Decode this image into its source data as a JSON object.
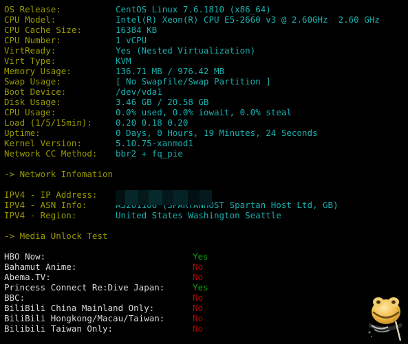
{
  "terminal": {
    "background": "#000000",
    "label_color": "#9a9a00",
    "value_color": "#1ab0b0",
    "media_label_color": "#d9d9d9",
    "yes_color": "#0ea60e",
    "no_color": "#c00000"
  },
  "system_info": [
    {
      "label": "OS Release:",
      "value": "CentOS Linux 7.6.1810 (x86_64)"
    },
    {
      "label": "CPU Model:",
      "value": "Intel(R) Xeon(R) CPU E5-2660 v3 @ 2.60GHz  2.60 GHz"
    },
    {
      "label": "CPU Cache Size:",
      "value": "16384 KB"
    },
    {
      "label": "CPU Number:",
      "value": "1 vCPU"
    },
    {
      "label": "VirtReady:",
      "value": "Yes (Nested Virtualization)"
    },
    {
      "label": "Virt Type:",
      "value": "KVM"
    },
    {
      "label": "Memory Usage:",
      "value": "136.71 MB / 976.42 MB"
    },
    {
      "label": "Swap Usage:",
      "value": "[ No Swapfile/Swap Partition ]"
    },
    {
      "label": "Boot Device:",
      "value": "/dev/vda1"
    },
    {
      "label": "Disk Usage:",
      "value": "3.46 GB / 20.58 GB"
    },
    {
      "label": "CPU Usage:",
      "value": "0.0% used, 0.0% iowait, 0.0% steal"
    },
    {
      "label": "Load (1/5/15min):",
      "value": "0.20 0.18 0.20"
    },
    {
      "label": "Uptime:",
      "value": "0 Days, 0 Hours, 19 Minutes, 24 Seconds"
    },
    {
      "label": "Kernel Version:",
      "value": "5.10.75-xanmod1"
    },
    {
      "label": "Network CC Method:",
      "value": "bbr2 + fq_pie"
    }
  ],
  "network_section": {
    "heading": "-> Network Infomation",
    "rows": [
      {
        "label": "IPV4 - IP Address:",
        "value": "",
        "redacted": true
      },
      {
        "label": "IPV4 - ASN Info:",
        "value": "AS201106 (SPARTANHOST Spartan Host Ltd, GB)"
      },
      {
        "label": "IPV4 - Region:",
        "value": "United States Washington Seattle"
      }
    ]
  },
  "media_section": {
    "heading": "-> Media Unlock Test",
    "rows": [
      {
        "label": "HBO Now:",
        "value": "Yes"
      },
      {
        "label": "Bahamut Anime:",
        "value": "No"
      },
      {
        "label": "Abema.TV:",
        "value": "No"
      },
      {
        "label": "Princess Connect Re:Dive Japan:",
        "value": "Yes"
      },
      {
        "label": "BBC:",
        "value": "No"
      },
      {
        "label": "BiliBili China Mainland Only:",
        "value": "No"
      },
      {
        "label": "BiliBili Hongkong/Macau/Taiwan:",
        "value": "No"
      },
      {
        "label": "Bilibili Taiwan Only:",
        "value": "No"
      }
    ]
  },
  "watermark": {
    "name": "cartoon-frog-mascot"
  }
}
